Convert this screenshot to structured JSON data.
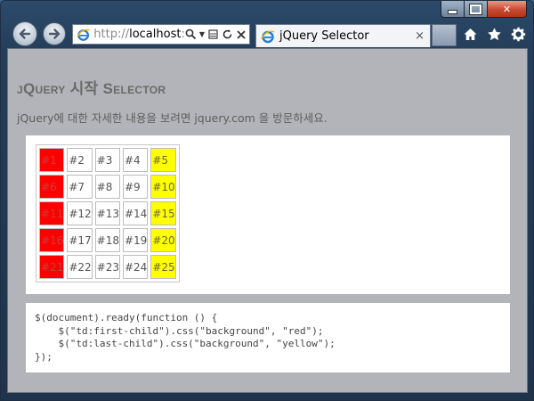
{
  "browser": {
    "address_url_prefix": "http://",
    "address_url_host": "localhost",
    "address_url_tail": ":",
    "tab_title": "jQuery Selector",
    "tab_close": "×"
  },
  "page": {
    "title": "jQuery 시작 Selector",
    "subtitle": "jQuery에 대한 자세한 내용을 보려면 jquery.com 을 방문하세요.",
    "table_rows": [
      [
        "#1",
        "#2",
        "#3",
        "#4",
        "#5"
      ],
      [
        "#6",
        "#7",
        "#8",
        "#9",
        "#10"
      ],
      [
        "#11",
        "#12",
        "#13",
        "#14",
        "#15"
      ],
      [
        "#16",
        "#17",
        "#18",
        "#19",
        "#20"
      ],
      [
        "#21",
        "#22",
        "#23",
        "#24",
        "#25"
      ]
    ],
    "code_lines": [
      "$(document).ready(function () {",
      "    $(\"td:first-child\").css(\"background\", \"red\");",
      "    $(\"td:last-child\").css(\"background\", \"yellow\");",
      "});"
    ]
  },
  "colors": {
    "first_child_bg": "#ff0000",
    "last_child_bg": "#ffff00",
    "viewport_bg": "#b3b4b9"
  },
  "icons": [
    "back-arrow-icon",
    "forward-arrow-icon",
    "ie-logo-icon",
    "search-icon",
    "compat-view-icon",
    "refresh-icon",
    "stop-icon",
    "home-icon",
    "favorites-star-icon",
    "tools-gear-icon",
    "minimize-icon",
    "maximize-icon",
    "close-icon"
  ]
}
